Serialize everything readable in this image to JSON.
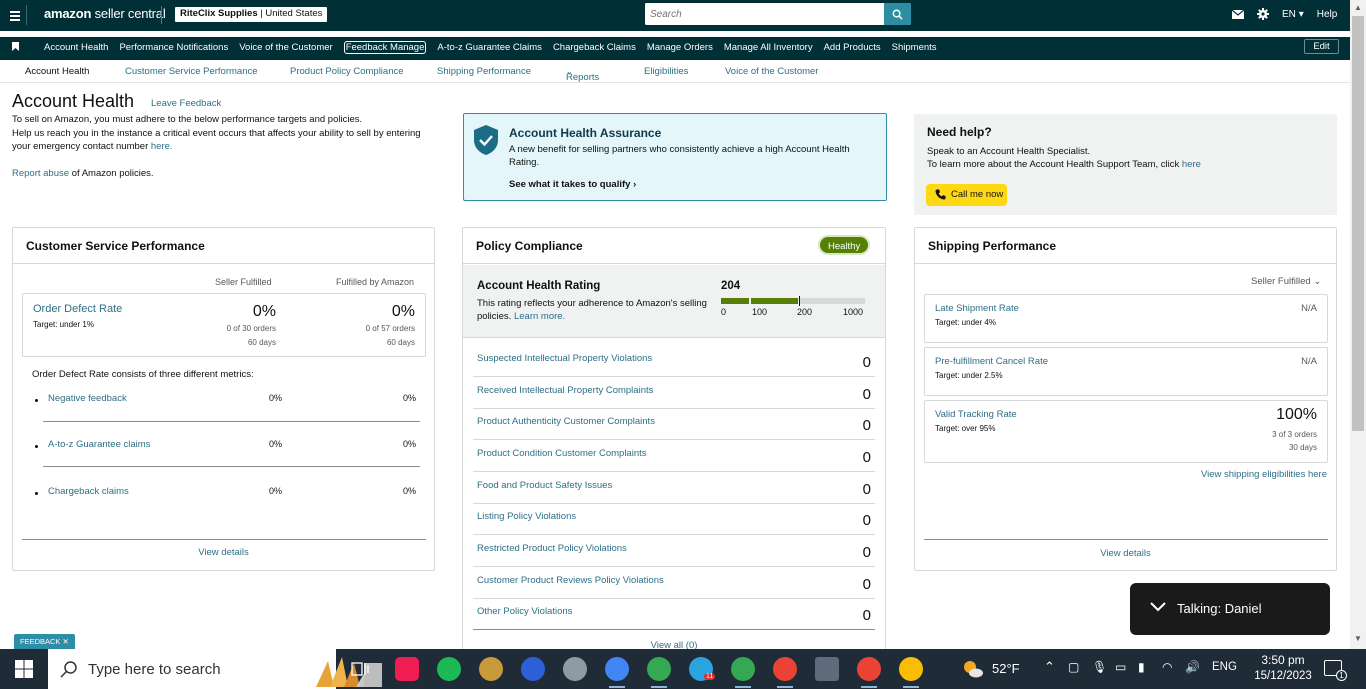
{
  "topbar": {
    "logo_brand": "amazon",
    "logo_suffix": "seller central",
    "store_name": "RiteClix Supplies",
    "store_region": "United States",
    "search_placeholder": "Search",
    "lang": "EN",
    "help": "Help"
  },
  "nav": {
    "items": [
      "Account Health",
      "Performance Notifications",
      "Voice of the Customer",
      "Feedback Manage",
      "A-to-z Guarantee Claims",
      "Chargeback Claims",
      "Manage Orders",
      "Manage All Inventory",
      "Add Products",
      "Shipments"
    ],
    "edit": "Edit"
  },
  "subtabs": [
    "Account Health",
    "Customer Service Performance",
    "Product Policy Compliance",
    "Shipping Performance",
    "Reports",
    "Eligibilities",
    "Voice of the Customer"
  ],
  "header": {
    "title": "Account Health",
    "leave_feedback": "Leave Feedback",
    "intro1": "To sell on Amazon, you must adhere to the below performance targets and policies.",
    "intro2": "Help us reach you in the instance a critical event occurs that affects your ability to sell by entering",
    "intro3_prefix": "your emergency contact number",
    "intro3_link": "here.",
    "report_link": "Report abuse",
    "report_suffix": "of Amazon policies."
  },
  "assurance": {
    "title": "Account Health Assurance",
    "desc": "A new benefit for selling partners who consistently achieve a high Account Health Rating.",
    "link": "See what it takes to qualify"
  },
  "help": {
    "title": "Need help?",
    "line1": "Speak to an Account Health Specialist.",
    "line2_prefix": "To learn more about the Account Health Support Team, click",
    "line2_link": "here",
    "call_button": "Call me now"
  },
  "csp": {
    "title": "Customer Service Performance",
    "col_seller": "Seller Fulfilled",
    "col_fba": "Fulfilled by Amazon",
    "odr": {
      "name": "Order Defect Rate",
      "target": "Target: under 1%",
      "seller_value": "0%",
      "seller_orders": "0 of 30 orders",
      "seller_days": "60 days",
      "fba_value": "0%",
      "fba_orders": "0 of 57 orders",
      "fba_days": "60 days"
    },
    "consists": "Order Defect Rate consists of three different metrics:",
    "metrics": [
      {
        "name": "Negative feedback",
        "seller": "0%",
        "fba": "0%"
      },
      {
        "name": "A-to-z Guarantee claims",
        "seller": "0%",
        "fba": "0%"
      },
      {
        "name": "Chargeback claims",
        "seller": "0%",
        "fba": "0%"
      }
    ],
    "view_details": "View details"
  },
  "policy": {
    "title": "Policy Compliance",
    "badge": "Healthy",
    "ahr_title": "Account Health Rating",
    "ahr_desc_prefix": "This rating reflects your adherence to Amazon's selling policies.",
    "ahr_desc_link": "Learn more.",
    "ahr_score": "204",
    "ahr_score_value": 204,
    "ahr_scale": [
      "0",
      "100",
      "200",
      "1000"
    ],
    "rows": [
      {
        "name": "Suspected Intellectual Property Violations",
        "value": "0"
      },
      {
        "name": "Received Intellectual Property Complaints",
        "value": "0"
      },
      {
        "name": "Product Authenticity Customer Complaints",
        "value": "0"
      },
      {
        "name": "Product Condition Customer Complaints",
        "value": "0"
      },
      {
        "name": "Food and Product Safety Issues",
        "value": "0"
      },
      {
        "name": "Listing Policy Violations",
        "value": "0"
      },
      {
        "name": "Restricted Product Policy Violations",
        "value": "0"
      },
      {
        "name": "Customer Product Reviews Policy Violations",
        "value": "0"
      },
      {
        "name": "Other Policy Violations",
        "value": "0"
      }
    ],
    "view_all": "View all (0)"
  },
  "shipping": {
    "title": "Shipping Performance",
    "dropdown": "Seller Fulfilled",
    "late": {
      "name": "Late Shipment Rate",
      "target": "Target: under 4%",
      "value": "N/A"
    },
    "cancel": {
      "name": "Pre-fulfillment Cancel Rate",
      "target": "Target: under 2.5%",
      "value": "N/A"
    },
    "vtr": {
      "name": "Valid Tracking Rate",
      "target": "Target: over 95%",
      "value": "100%",
      "orders": "3 of 3 orders",
      "days": "30 days"
    },
    "eligibilities": "View shipping eligibilities here",
    "view_details": "View details"
  },
  "toast": {
    "text": "Talking: Daniel"
  },
  "feedback_tab": "FEEDBACK",
  "taskbar": {
    "search": "Type here to search",
    "temperature": "52°F",
    "lang": "ENG",
    "time": "3:50 pm",
    "date": "15/12/2023",
    "notifications": "1",
    "telegram_badge": "11"
  },
  "colors": {
    "header_bg": "#002f36",
    "link": "#2f6f86",
    "healthy": "#567f06",
    "call_button": "#ffd814",
    "assurance_bg": "#e5f6fa"
  }
}
